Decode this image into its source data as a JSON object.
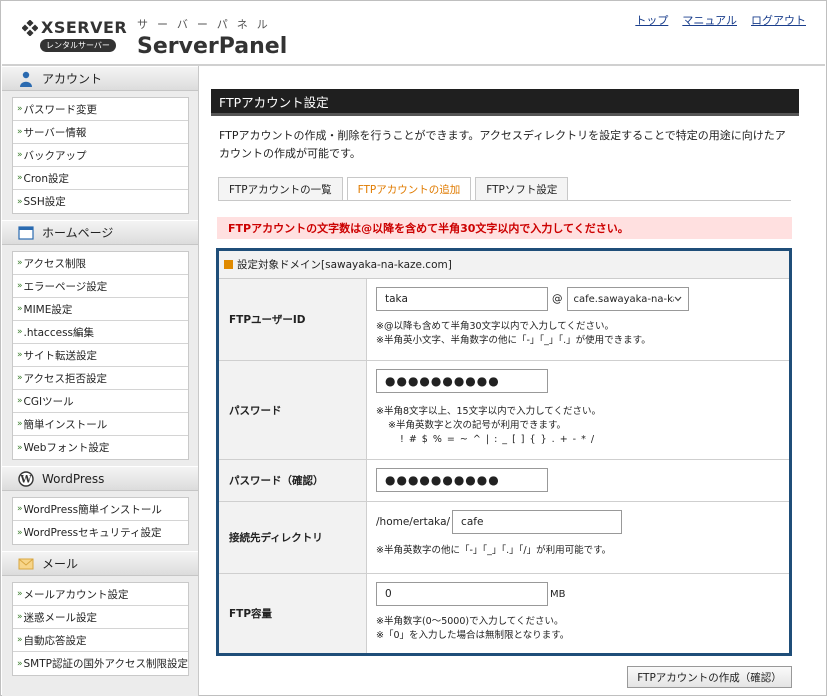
{
  "header": {
    "logo_text": "XSERVER",
    "logo_badge": "レンタルサーバー",
    "brand_kana": "サーバーパネル",
    "brand_name": "ServerPanel",
    "links": [
      "トップ",
      "マニュアル",
      "ログアウト"
    ]
  },
  "sidebar": {
    "sections": [
      {
        "title": "アカウント",
        "icon": "person-icon",
        "items": [
          "パスワード変更",
          "サーバー情報",
          "バックアップ",
          "Cron設定",
          "SSH設定"
        ]
      },
      {
        "title": "ホームページ",
        "icon": "webpage-icon",
        "items": [
          "アクセス制限",
          "エラーページ設定",
          "MIME設定",
          ".htaccess編集",
          "サイト転送設定",
          "アクセス拒否設定",
          "CGIツール",
          "簡単インストール",
          "Webフォント設定"
        ]
      },
      {
        "title": "WordPress",
        "icon": "wordpress-icon",
        "items": [
          "WordPress簡単インストール",
          "WordPressセキュリティ設定"
        ]
      },
      {
        "title": "メール",
        "icon": "envelope-icon",
        "items": [
          "メールアカウント設定",
          "迷惑メール設定",
          "自動応答設定",
          "SMTP認証の国外アクセス制限設定"
        ]
      }
    ]
  },
  "main": {
    "title": "FTPアカウント設定",
    "description": "FTPアカウントの作成・削除を行うことができます。アクセスディレクトリを設定することで特定の用途に向けたアカウントの作成が可能です。",
    "tabs": [
      "FTPアカウントの一覧",
      "FTPアカウントの追加",
      "FTPソフト設定"
    ],
    "active_tab": 1,
    "alert": "FTPアカウントの文字数は@以降を含めて半角30文字以内で入力してください。",
    "domain_header": "設定対象ドメイン[sawayaka-na-kaze.com]",
    "form": {
      "user_id": {
        "label": "FTPユーザーID",
        "value": "taka",
        "at": "@",
        "domain_select": "cafe.sawayaka-na-ka",
        "note1": "※@以降も含めて半角30文字以内で入力してください。",
        "note2": "※半角英小文字、半角数字の他に「-」「_」「.」が使用できます。"
      },
      "password": {
        "label": "パスワード",
        "value": "●●●●●●●●●●",
        "note1": "※半角8文字以上、15文字以内で入力してください。",
        "note2": "※半角英数字と次の記号が利用できます。",
        "symbols": "! # $ % = ~ ^ | : _ [ ] { } . + - * /"
      },
      "password_confirm": {
        "label": "パスワード（確認）",
        "value": "●●●●●●●●●●"
      },
      "directory": {
        "label": "接続先ディレクトリ",
        "prefix": "/home/ertaka/",
        "value": "cafe",
        "note": "※半角英数字の他に「-」「_」「.」「/」が利用可能です。"
      },
      "quota": {
        "label": "FTP容量",
        "value": "0",
        "unit": "MB",
        "note1": "※半角数字(0～5000)で入力してください。",
        "note2": "※「0」を入力した場合は無制限となります。"
      }
    },
    "submit": "FTPアカウントの作成（確認）"
  }
}
